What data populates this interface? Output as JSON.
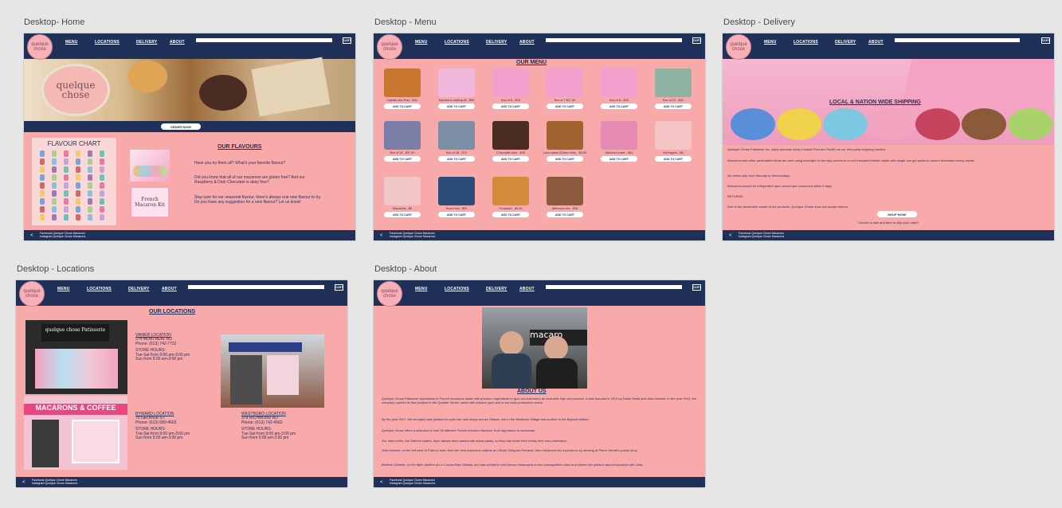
{
  "artboard_titles": {
    "home": "Desktop- Home",
    "menu": "Desktop - Menu",
    "delivery": "Desktop - Delivery",
    "locations": "Desktop - Locations",
    "about": "Desktop - About"
  },
  "header": {
    "logo": "quelque chose",
    "nav": [
      "MENU",
      "LOCATIONS",
      "DELIVERY",
      "ABOUT"
    ],
    "cart": "CART"
  },
  "footer": {
    "line1": "Facebook Quelque Chose Macarons",
    "line2": "Instagram Quelque Chose Macarons"
  },
  "home": {
    "hero_label": "quelque chose",
    "order_button": "ORDER NOW!",
    "chart_title": "FLAVOUR CHART",
    "flavours_title": "OUR FLAVOURS",
    "p1": "Have you try them all? What's your favorite flavour?",
    "p2": "Did you know that all of our macarons are gluten free? And our Raspberry & Dark Chocolate is dairy free?",
    "p3": "Stay tune for our seasonal flavour, there's always one new flavour to try. Do you have any suggestion for a new flavour? Let us know!",
    "kit_label": "French Macaron Kit"
  },
  "menu": {
    "title": "OUR MENU",
    "add_label": "ADD TO CART",
    "products": [
      {
        "name": "Galette des Rois - $30",
        "color": "#c9772e"
      },
      {
        "name": "Macarons making kit - $59",
        "color": "#f1b7dc"
      },
      {
        "name": "Box of 6 - $15",
        "color": "#f2a1cf"
      },
      {
        "name": "Box of 7 $17.50",
        "color": "#f2a1cf"
      },
      {
        "name": "Box of 8 - $20",
        "color": "#f2a1cf"
      },
      {
        "name": "Box of 12 - $30",
        "color": "#8fb3a3"
      },
      {
        "name": "Box of 15 - $37.50",
        "color": "#7b7ea6"
      },
      {
        "name": "Box of 28 - $70",
        "color": "#7b8ea6"
      },
      {
        "name": "Chocolate cake - $35",
        "color": "#4a2c22"
      },
      {
        "name": "Lava cakes (Gluten free) - $5.50",
        "color": "#a0622e"
      },
      {
        "name": "Macaron tower - $44",
        "color": "#e68bb4"
      },
      {
        "name": "Meringues - $5",
        "color": "#f5c4c4"
      },
      {
        "name": "Macarinis - $5",
        "color": "#f1c6c6"
      },
      {
        "name": "Kusmi tea - $20",
        "color": "#2c4c7a"
      },
      {
        "name": "Croissant - $3.40",
        "color": "#d38b3a"
      },
      {
        "name": "Afternoon tea - $36",
        "color": "#8b5a3c"
      }
    ]
  },
  "delivery": {
    "title": "LOCAL & NATION WIDE SHIPPING",
    "p1": "Quelque Chose Patisserie Inc. ships products using Canada Post and FedEx as our third party shipping carriers.",
    "p2": "Macarons and other perishables items are sent using overnight or two-day service in a cool insulated bubble mailer with single-use gel packs to ensure freshness during transit.",
    "p3": "All orders ship from Monday to Wednesdays.",
    "p4": "Macarons should be refrigerated upon arrival and consumed within 5 days.",
    "returns_label": "RETURNS:",
    "p5": "Due to the perishable nature of the products, Quelque Chose does not accept returns.",
    "shop_button": "SHOP NOW!",
    "p6": "Choose a date and time to ship your order!"
  },
  "locations": {
    "title": "OUR LOCATIONS",
    "vanier": {
      "name": "VANIER LOCATION",
      "address": "274 MONTREAL RD",
      "phone": "Phone: (613) 742-7722",
      "hours_label": "STORE HOURS:",
      "hours1": "Tue-Sat from 9:00 am-3:00 pm",
      "hours2": "Sun from 9:00 am-3:00 pm"
    },
    "byward": {
      "name": "BYWARD LOCATION",
      "address": "70 GEORGE ST",
      "phone": "Phone: (613) 680-4563",
      "hours_label": "STORE HOURS:",
      "hours1": "Tue-Sat from 9:00 am-3:00 pm",
      "hours2": "Sun from 9:00 am-3:00 pm"
    },
    "westboro": {
      "name": "WESTBORO LOCATION",
      "address": "379 RICHMOND RD",
      "phone": "Phone: (613) 742-4562",
      "hours_label": "STORE HOURS:",
      "hours1": "Tue-Sat from 9:00 am-3:00 pm",
      "hours2": "Sun from 9:00 am-3:00 pm"
    },
    "storefront_sign": "MACARONS & COFFEE",
    "shop_sign": "quelque chose Patisserie"
  },
  "about": {
    "title": "ABOUT US",
    "photo_sign": "macaro",
    "p1": "Quelque Chose Pâtisserie specializes in French macarons made with premium ingredients to give our customers an exclusive high-end product. It was founded in 2013 by Dalila Sebai and Julia Dahesh. In the year 2013, the company opened its first location in the Quartier Vanier, which still remains open and is our main production centre.",
    "p2": "By the year 2017, the company was pleased to open two new shops across Ottawa, one in the Westboro Village and another in the Byward Market.",
    "p3": "Quelque Chose offers a selection of over 50 different French macaron flavours, from signatures to seasonals.",
    "p4": "Our main chefs, the Dahesh sisters, have always been passionate about pastry, so they had made their hobby their own profession.",
    "p5": "Julia Dahesh, on the left went to Paris to learn from the best macarons maitres at L'École Grégoire-Ferrandi, then enhanced her experience by working at Pierre Hermé's pastry shop.",
    "p6": "Marlène Dahesh, on the right, studied at Le Cordon Bleu Ottawa, and has worked in well-known restaurants in two cosmopolitan cities and shares her passion about macarons with Julia."
  },
  "colors": {
    "navy": "#1f3158",
    "pink": "#f8a9aa",
    "canvas": "#e6e6e6"
  }
}
